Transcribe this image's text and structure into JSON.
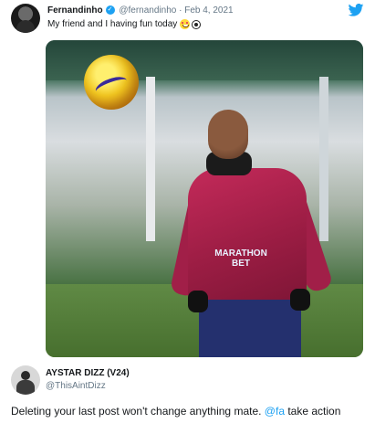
{
  "tweet": {
    "author_name": "Fernandinho",
    "author_handle": "@fernandinho",
    "separator": "·",
    "date": "Feb 4, 2021",
    "text": "My friend and I having fun today",
    "emojis": [
      "grinning-face-with-heart-eyes",
      "soccer-ball"
    ],
    "verified": true
  },
  "image": {
    "sponsor": "MARATHON\nBET"
  },
  "reply": {
    "author_name": "AYSTAR DIZZ (V24)",
    "author_handle": "@ThisAintDizz",
    "text_before": "Deleting your last post won't change anything mate. ",
    "mention": "@fa",
    "text_after": " take action"
  },
  "colors": {
    "link": "#1da1f2",
    "muted": "#657786",
    "text": "#14171a"
  }
}
